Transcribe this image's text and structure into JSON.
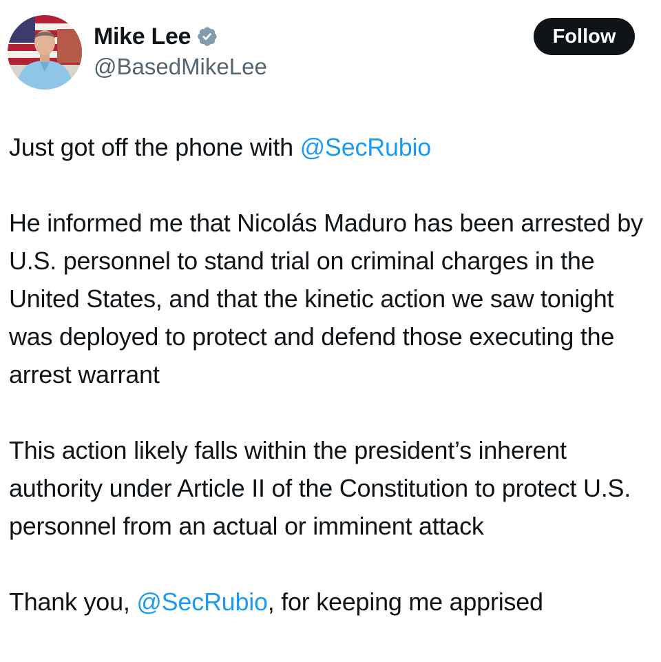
{
  "author": {
    "display_name": "Mike Lee",
    "handle": "@BasedMikeLee",
    "verified_icon": "verified-badge-icon",
    "verified_color": "#829aab",
    "avatar_icon": "profile-avatar"
  },
  "follow_button": {
    "label": "Follow"
  },
  "tweet": {
    "mention": "@SecRubio",
    "p1_text": "Just got off the phone with ",
    "p2_text": "He informed me that Nicolás Maduro has been arrested by U.S. personnel to stand trial on criminal charges in the United States, and that the kinetic action we saw tonight was deployed to protect and defend those executing the arrest warrant",
    "p3_text": "This action likely falls within the president’s inherent authority under Article II of the Constitution to protect U.S. personnel from an actual or imminent attack",
    "p4_before": "Thank you, ",
    "p4_after": ", for keeping me apprised"
  },
  "colors": {
    "text": "#0f1419",
    "secondary": "#536471",
    "link": "#1d9bf0",
    "button_bg": "#0f1419",
    "button_text": "#ffffff"
  }
}
